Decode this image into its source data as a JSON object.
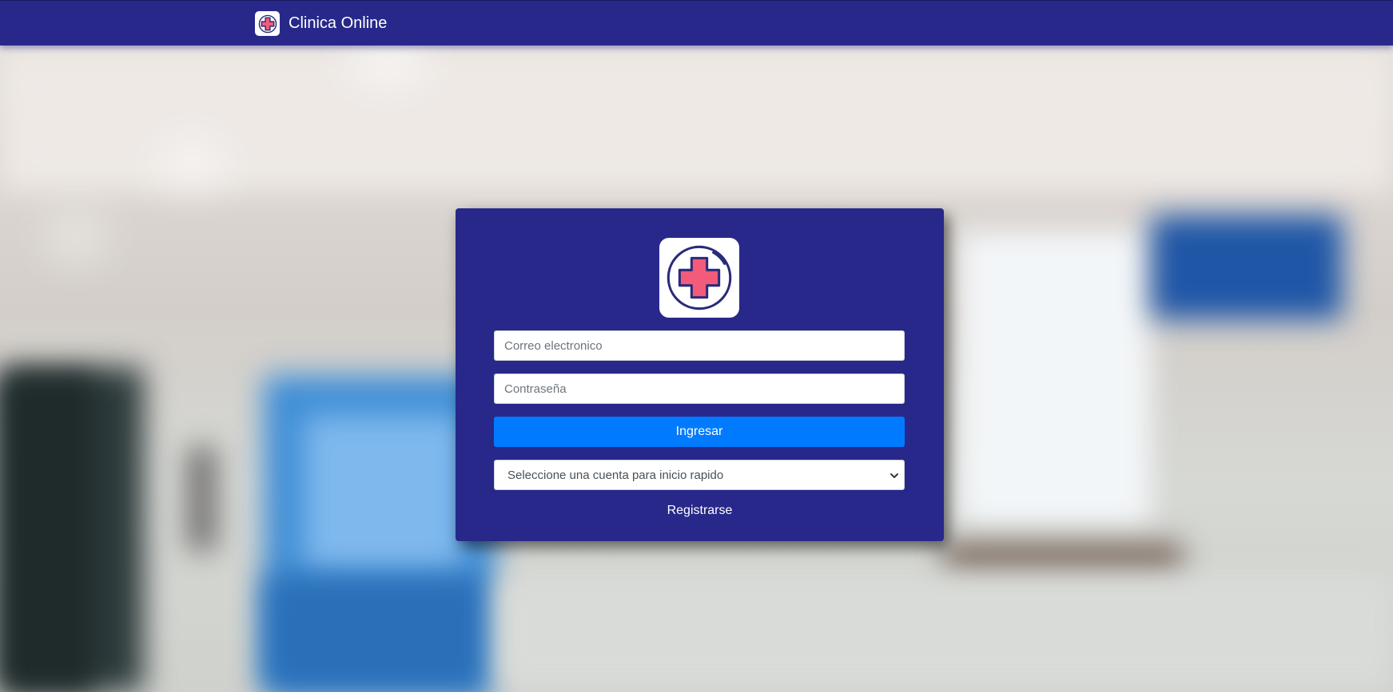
{
  "navbar": {
    "brand_name": "Clinica Online",
    "brand_icon": "medical-cross-icon"
  },
  "login": {
    "logo_icon": "medical-cross-icon",
    "email_placeholder": "Correo electronico",
    "password_placeholder": "Contraseña",
    "submit_label": "Ingresar",
    "quick_account_selected": "Seleccione una cuenta para inicio rapido",
    "register_label": "Registrarse"
  },
  "colors": {
    "navbar_bg": "#28288a",
    "card_bg": "#28288a",
    "primary_button": "#007bff",
    "cross_fill": "#f25b7a",
    "cross_stroke": "#2b2b7a"
  }
}
